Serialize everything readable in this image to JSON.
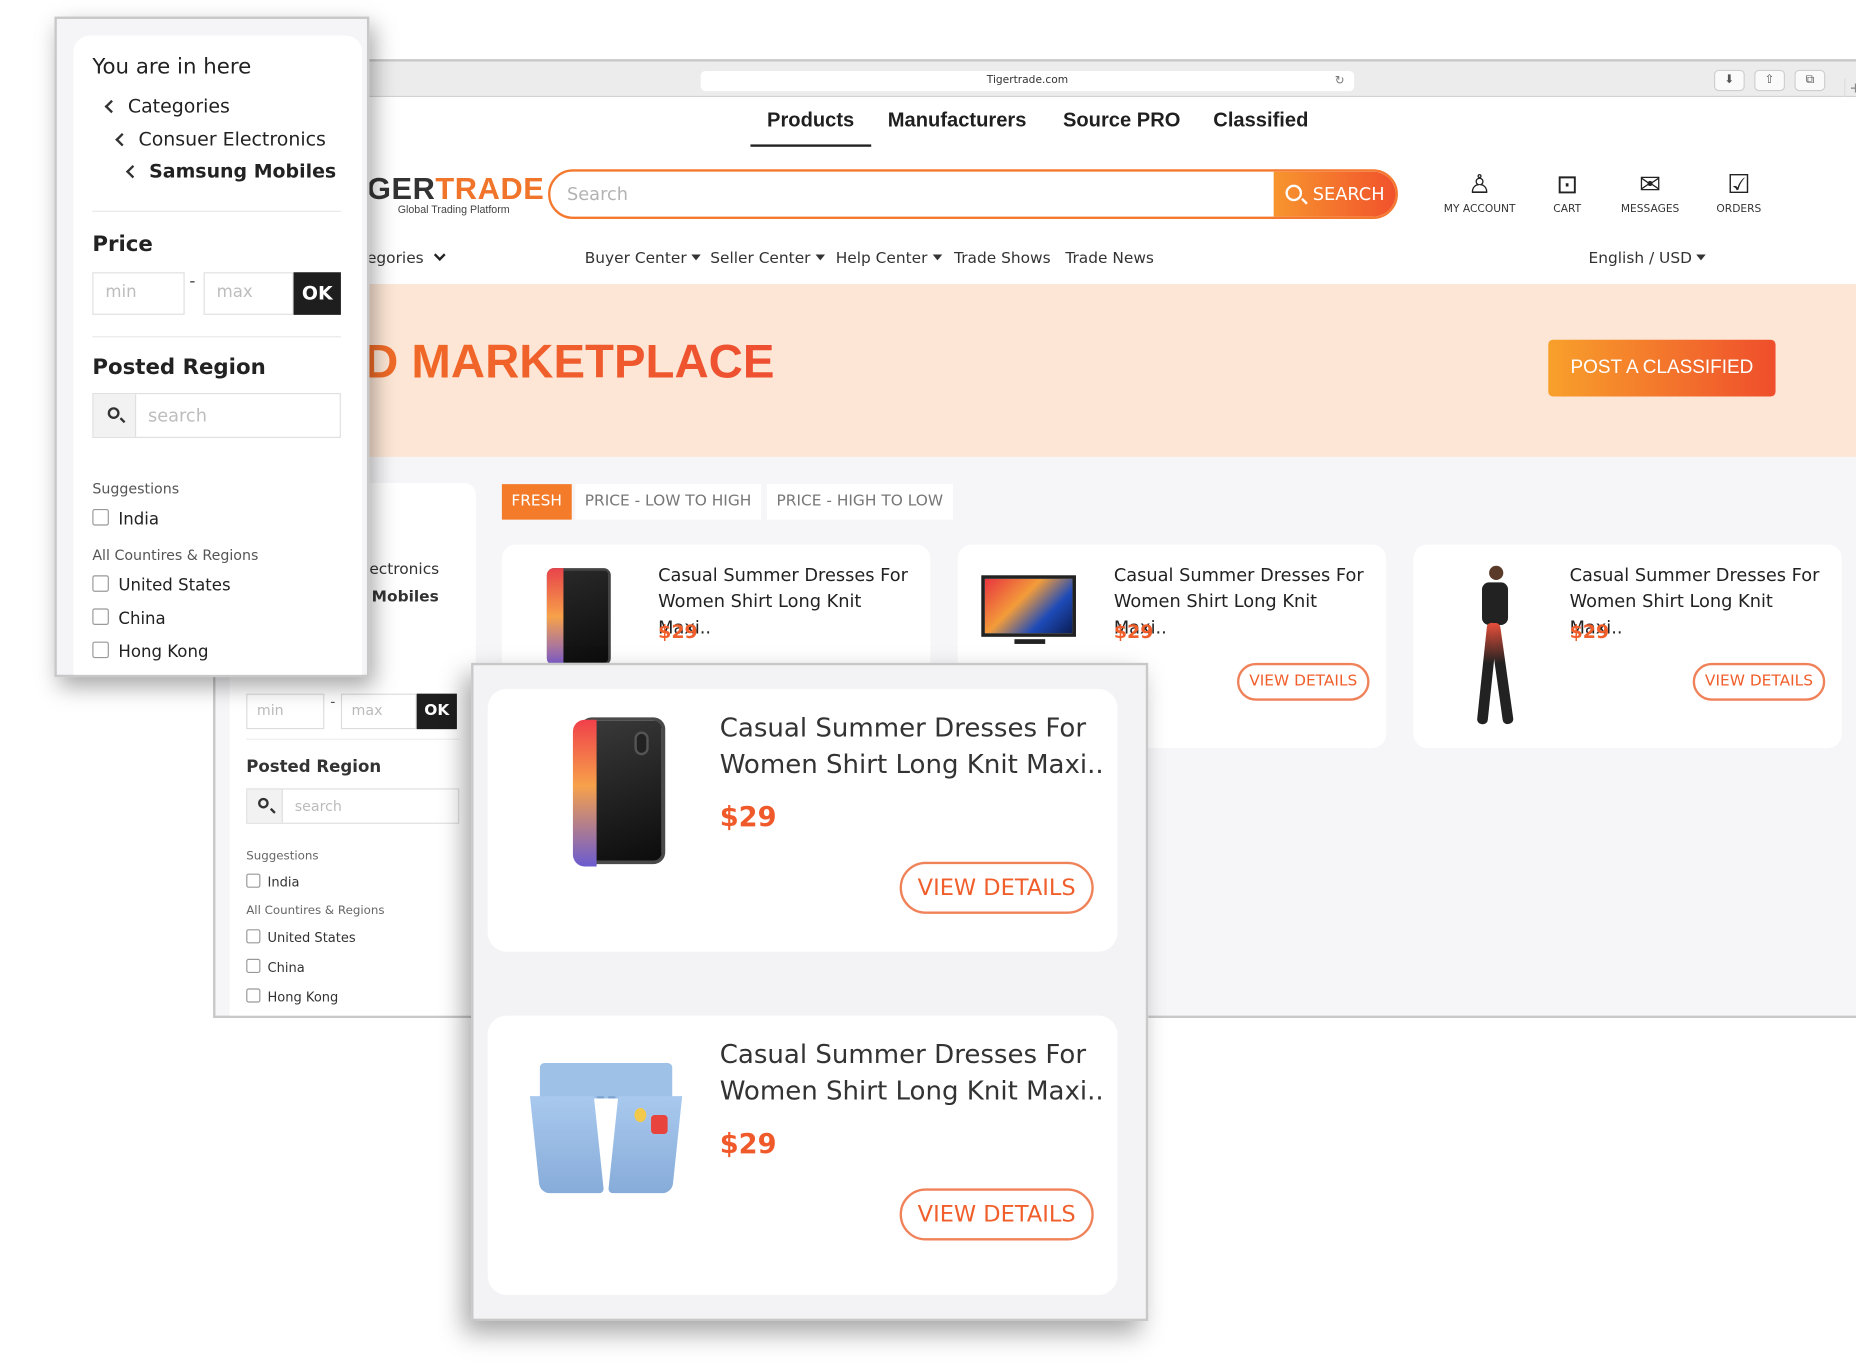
{
  "browser": {
    "url": "Tigertrade.com"
  },
  "nav": {
    "tabs": [
      "Products",
      "Manufacturers",
      "Source PRO",
      "Classified"
    ],
    "active": "Products"
  },
  "logo": {
    "text_dark": "GER",
    "text_accent": "TRADE",
    "tagline": "Global Trading Platform"
  },
  "search": {
    "placeholder": "Search",
    "button": "SEARCH"
  },
  "account": {
    "my_account": "MY ACCOUNT",
    "cart": "CART",
    "messages": "MESSAGES",
    "orders": "ORDERS"
  },
  "subnav": {
    "categories": "egories",
    "items": [
      "Buyer Center",
      "Seller Center",
      "Help Center",
      "Trade Shows",
      "Trade News"
    ],
    "locale": "English / USD"
  },
  "banner": {
    "title": "ASSIFIED MARKETPLACE",
    "post_button": "POST A CLASSIFIED"
  },
  "sort": {
    "options": [
      "FRESH",
      "PRICE - LOW TO HIGH",
      "PRICE - HIGH TO LOW"
    ],
    "active": "FRESH"
  },
  "products": [
    {
      "title": "Casual Summer Dresses For Women Shirt Long Knit Maxi..",
      "price": "$29",
      "action": "VIEW DETAILS",
      "image": "phone"
    },
    {
      "title": "Casual Summer Dresses For Women Shirt Long Knit Maxi..",
      "price": "$29",
      "action": "VIEW DETAILS",
      "image": "tv"
    },
    {
      "title": "Casual Summer Dresses For Women Shirt Long Knit Maxi..",
      "price": "$29",
      "action": "VIEW DETAILS",
      "image": "woman"
    }
  ],
  "sidebar": {
    "crumb_partial_1": "ectronics",
    "crumb_partial_2": "Mobiles",
    "min_placeholder": "min",
    "max_placeholder": "max",
    "ok": "OK",
    "posted_region": "Posted Region",
    "search_placeholder": "search",
    "suggestions": "Suggestions",
    "suggested": [
      "India"
    ],
    "all_regions": "All Countires & Regions",
    "countries": [
      "United States",
      "China",
      "Hong Kong"
    ]
  },
  "filter_panel": {
    "heading": "You are in here",
    "breadcrumb": [
      "Categories",
      "Consuer Electronics",
      "Samsung Mobiles"
    ],
    "price_label": "Price",
    "min_placeholder": "min",
    "max_placeholder": "max",
    "ok": "OK",
    "posted_region": "Posted Region",
    "search_placeholder": "search",
    "suggestions": "Suggestions",
    "suggested": [
      "India"
    ],
    "all_regions": "All Countires & Regions",
    "countries": [
      "United States",
      "China",
      "Hong Kong"
    ]
  },
  "zoom_products": [
    {
      "title_line1": "Casual Summer Dresses For",
      "title_line2": "Women Shirt Long Knit Maxi..",
      "price": "$29",
      "action": "VIEW DETAILS",
      "image": "phone"
    },
    {
      "title_line1": "Casual Summer Dresses For",
      "title_line2": "Women Shirt Long Knit Maxi..",
      "price": "$29",
      "action": "VIEW DETAILS",
      "image": "shorts"
    }
  ],
  "colors": {
    "accent": "#f47b2a",
    "accent_red": "#ef4e2c",
    "banner_bg": "#fde6d5",
    "dark": "#1e1e1e"
  }
}
